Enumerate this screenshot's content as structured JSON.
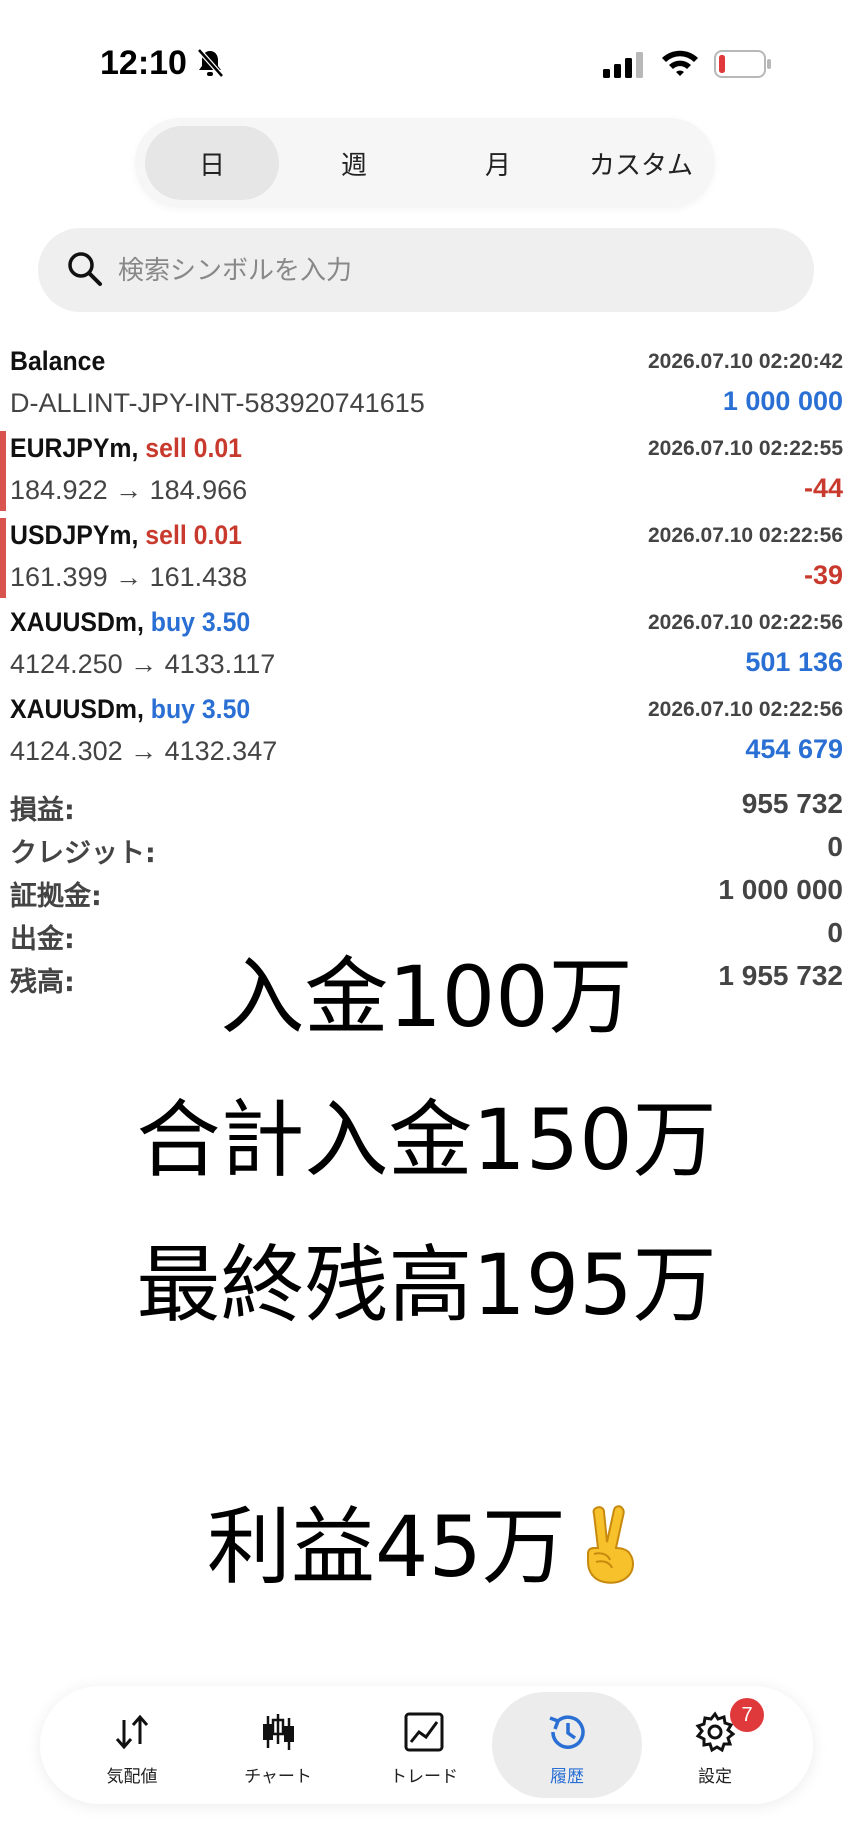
{
  "status_bar": {
    "time": "12:10"
  },
  "period_tabs": [
    {
      "label": "日",
      "active": true
    },
    {
      "label": "週",
      "active": false
    },
    {
      "label": "月",
      "active": false
    },
    {
      "label": "カスタム",
      "active": false
    }
  ],
  "search": {
    "placeholder": "検索シンボルを入力"
  },
  "balance_row": {
    "title": "Balance",
    "time": "2026.07.10 02:20:42",
    "account": "D-ALLINT-JPY-INT-583920741615",
    "amount": "1 000 000"
  },
  "deals": [
    {
      "symbol": "EURJPYm,",
      "side": "sell 0.01",
      "side_type": "sell",
      "time": "2026.07.10 02:22:55",
      "prices": "184.922 → 184.966",
      "profit": "-44"
    },
    {
      "symbol": "USDJPYm,",
      "side": "sell 0.01",
      "side_type": "sell",
      "time": "2026.07.10 02:22:56",
      "prices": "161.399 → 161.438",
      "profit": "-39"
    },
    {
      "symbol": "XAUUSDm,",
      "side": "buy 3.50",
      "side_type": "buy",
      "time": "2026.07.10 02:22:56",
      "prices": "4124.250 → 4133.117",
      "profit": "501 136"
    },
    {
      "symbol": "XAUUSDm,",
      "side": "buy 3.50",
      "side_type": "buy",
      "time": "2026.07.10 02:22:56",
      "prices": "4124.302 → 4132.347",
      "profit": "454 679"
    }
  ],
  "summary": [
    {
      "label": "損益:",
      "value": "955 732"
    },
    {
      "label": "クレジット:",
      "value": "0"
    },
    {
      "label": "証拠金:",
      "value": "1 000 000"
    },
    {
      "label": "出金:",
      "value": "0"
    },
    {
      "label": "残高:",
      "value": "1 955 732"
    }
  ],
  "overlay": {
    "line1": "入金100万",
    "line2": "合計入金150万",
    "line3": "最終残高195万",
    "line4": "利益45万"
  },
  "bottom_nav": [
    {
      "label": "気配値",
      "icon": "quotes-icon",
      "active": false
    },
    {
      "label": "チャート",
      "icon": "chart-icon",
      "active": false
    },
    {
      "label": "トレード",
      "icon": "trade-icon",
      "active": false
    },
    {
      "label": "履歴",
      "icon": "history-icon",
      "active": true
    },
    {
      "label": "設定",
      "icon": "gear-icon",
      "active": false,
      "badge": "7"
    }
  ],
  "colors": {
    "sell": "#c93a2e",
    "buy": "#2a6fd4",
    "badge": "#e0393b"
  }
}
